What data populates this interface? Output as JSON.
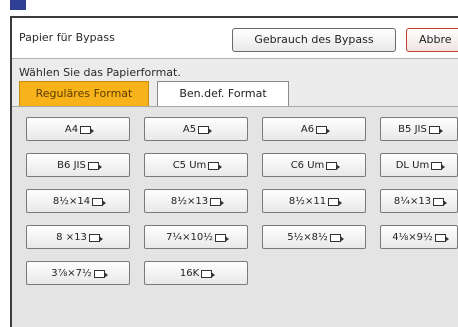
{
  "header": {
    "title": "Papier für Bypass",
    "use_bypass_label": "Gebrauch des Bypass",
    "cancel_label": "Abbre"
  },
  "prompt": "Wählen Sie das Papierformat.",
  "tabs": [
    {
      "label": "Reguläres Format",
      "selected": true
    },
    {
      "label": "Ben.def. Format",
      "selected": false
    }
  ],
  "sizes": [
    [
      "A4",
      "A5",
      "A6",
      "B5 JIS"
    ],
    [
      "B6 JIS",
      "C5 Um",
      "C6 Um",
      "DL Um"
    ],
    [
      "8½×14",
      "8½×13",
      "8½×11",
      "8¼×13"
    ],
    [
      "8 ×13",
      "7¼×10½",
      "5½×8½",
      "4⅛×9½"
    ],
    [
      "3⅞×7½",
      "16K"
    ]
  ],
  "colors": {
    "selected_tab": "#f8b31a",
    "cancel_border": "#c33a2e",
    "top_box": "#2f3f95"
  }
}
